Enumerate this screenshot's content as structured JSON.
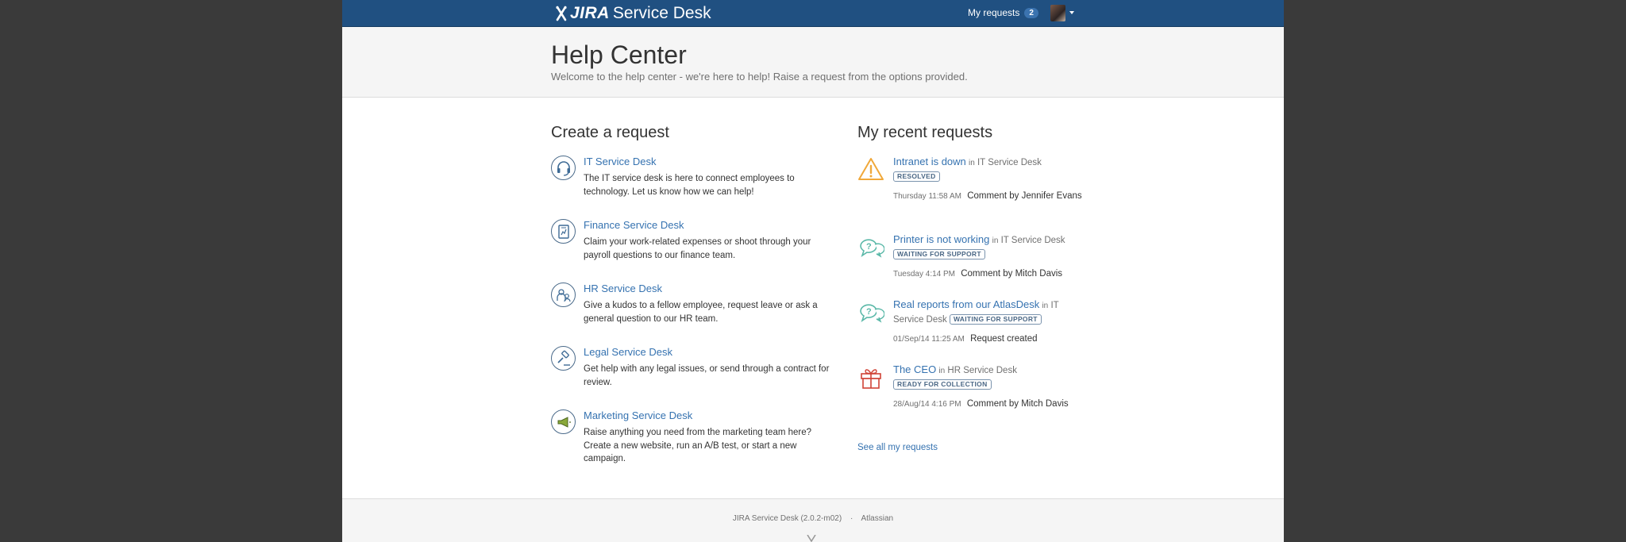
{
  "topbar": {
    "logo_jira": "JIRA",
    "logo_sd": "Service Desk",
    "my_requests_label": "My requests",
    "my_requests_count": "2"
  },
  "header": {
    "title": "Help Center",
    "subtitle": "Welcome to the help center - we're here to help! Raise a request from the options provided."
  },
  "create": {
    "title": "Create a request",
    "desks": [
      {
        "name": "IT Service Desk",
        "desc": "The IT service desk is here to connect employees to technology. Let us know how we can help!",
        "icon": "headset-icon"
      },
      {
        "name": "Finance Service Desk",
        "desc": "Claim your work-related expenses or shoot through your payroll questions to our finance team.",
        "icon": "document-chart-icon"
      },
      {
        "name": "HR Service Desk",
        "desc": "Give a kudos to a fellow employee, request leave or ask a general question to our HR team.",
        "icon": "people-icon"
      },
      {
        "name": "Legal Service Desk",
        "desc": "Get help with any legal issues, or send through a contract for review.",
        "icon": "gavel-icon"
      },
      {
        "name": "Marketing Service Desk",
        "desc": "Raise anything you need from the marketing team here? Create a new website, run an A/B test, or start a new campaign.",
        "icon": "megaphone-icon"
      }
    ]
  },
  "recent": {
    "title": "My recent requests",
    "in_label": "in",
    "requests": [
      {
        "title": "Intranet is down",
        "desk": "IT Service Desk",
        "status": "RESOLVED",
        "time": "Thursday 11:58 AM",
        "activity": "Comment by Jennifer Evans",
        "icon": "warning-icon"
      },
      {
        "title": "Printer is not working",
        "desk": "IT Service Desk",
        "status": "WAITING FOR SUPPORT",
        "time": "Tuesday 4:14 PM",
        "activity": "Comment by Mitch Davis",
        "icon": "question-bubble-icon"
      },
      {
        "title": "Real reports from our AtlasDesk",
        "desk": "IT Service Desk",
        "status": "WAITING FOR SUPPORT",
        "time": "01/Sep/14 11:25 AM",
        "activity": "Request created",
        "icon": "question-bubble-icon"
      },
      {
        "title": "The CEO",
        "desk": "HR Service Desk",
        "status": "READY FOR COLLECTION",
        "time": "28/Aug/14 4:16 PM",
        "activity": "Comment by Mitch Davis",
        "icon": "gift-icon"
      }
    ],
    "see_all": "See all my requests"
  },
  "footer": {
    "version": "JIRA Service Desk (2.0.2-m02)",
    "separator": "·",
    "atlassian": "Atlassian"
  },
  "colors": {
    "topbar": "#205081",
    "link": "#3572b0",
    "warning": "#f0a83a",
    "question": "#5ab8a8",
    "gift": "#d04437",
    "background": "#3a3a3a"
  }
}
